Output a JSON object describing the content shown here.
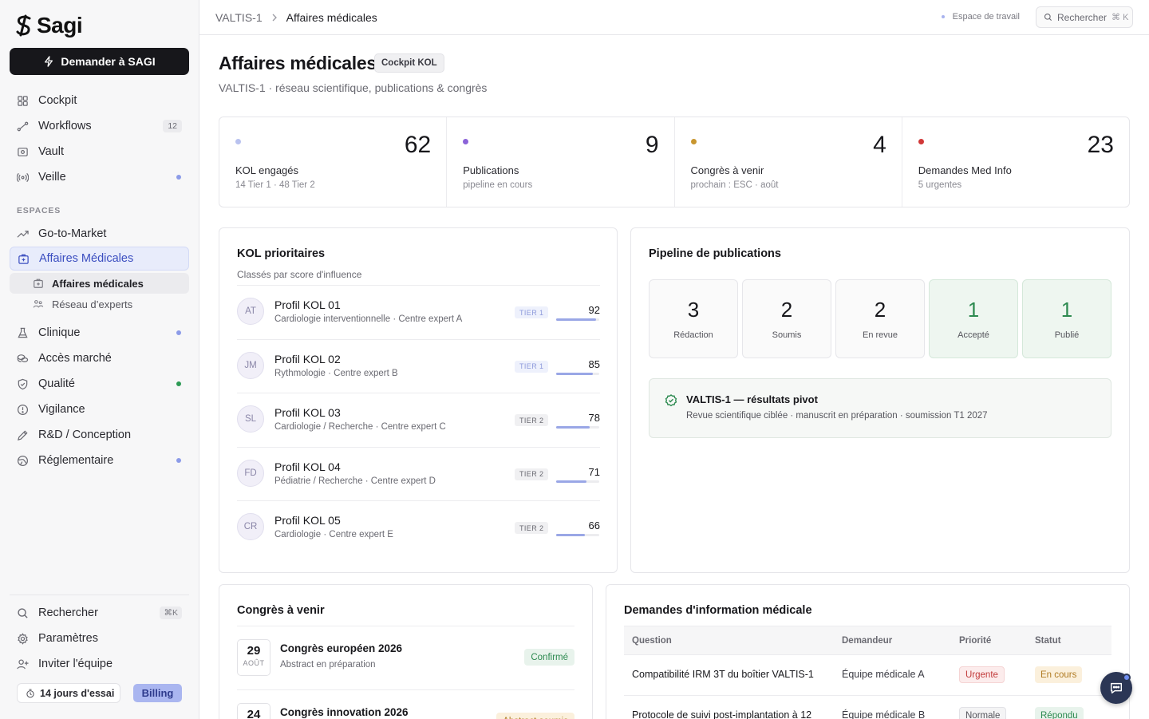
{
  "app": {
    "name": "Sagi"
  },
  "sidebar": {
    "ask_button": "Demander à SAGI",
    "items": [
      {
        "label": "Cockpit",
        "icon": "grid-icon"
      },
      {
        "label": "Workflows",
        "icon": "workflow-icon",
        "badge": "12"
      },
      {
        "label": "Vault",
        "icon": "vault-icon"
      },
      {
        "label": "Veille",
        "icon": "radar-icon"
      }
    ],
    "section_label": "ESPACES",
    "spaces": [
      {
        "label": "Go-to-Market",
        "icon": "trend-icon"
      },
      {
        "label": "Affaires Médicales",
        "icon": "medical-bag-icon"
      },
      {
        "label": "Clinique",
        "icon": "flask-icon"
      },
      {
        "label": "Accès marché",
        "icon": "coins-icon"
      },
      {
        "label": "Qualité",
        "icon": "shield-check-icon"
      },
      {
        "label": "Vigilance",
        "icon": "alert-circle-icon"
      },
      {
        "label": "R&D / Conception",
        "icon": "pencil-ruler-icon"
      },
      {
        "label": "Réglementaire",
        "icon": "globe-icon"
      }
    ],
    "subitems": [
      {
        "label": "Affaires médicales",
        "icon": "medical-bag-icon"
      },
      {
        "label": "Réseau d’experts",
        "icon": "network-icon"
      }
    ],
    "bottom": [
      {
        "label": "Rechercher",
        "icon": "search-icon",
        "kbd": "⌘K"
      },
      {
        "label": "Paramètres",
        "icon": "gear-icon"
      },
      {
        "label": "Inviter l'équipe",
        "icon": "user-plus-icon"
      }
    ],
    "trial": "14 jours d'essai",
    "billing": "Billing",
    "dot_colors": {
      "blue": "#8c9be8",
      "green": "#2d9a55"
    }
  },
  "topbar": {
    "breadcrumb": [
      "VALTIS-1",
      "Affaires médicales"
    ],
    "workspace": "Espace de travail",
    "search_placeholder": "Rechercher",
    "search_kbd": "⌘ K"
  },
  "page": {
    "title": "Affaires médicales",
    "chip": "Cockpit KOL",
    "subtitle": "VALTIS-1 · réseau scientifique, publications & congrès"
  },
  "stats": [
    {
      "value": "62",
      "label": "KOL engagés",
      "sub": "14 Tier 1 · 48 Tier 2",
      "color": "#b9c2ef"
    },
    {
      "value": "9",
      "label": "Publications",
      "sub": "pipeline en cours",
      "color": "#8b63d8"
    },
    {
      "value": "4",
      "label": "Congrès à venir",
      "sub": "prochain : ESC · août",
      "color": "#c8962f"
    },
    {
      "value": "23",
      "label": "Demandes Med Info",
      "sub": "5 urgentes",
      "color": "#d13838"
    }
  ],
  "kol": {
    "title": "KOL prioritaires",
    "subtitle": "Classés par score d'influence",
    "rows": [
      {
        "initials": "AT",
        "name": "Profil KOL 01",
        "spec": "Cardiologie interventionnelle · Centre expert A",
        "tier": "TIER 1",
        "score": "92",
        "level": 0.92
      },
      {
        "initials": "JM",
        "name": "Profil KOL 02",
        "spec": "Rythmologie · Centre expert B",
        "tier": "TIER 1",
        "score": "85",
        "level": 0.85
      },
      {
        "initials": "SL",
        "name": "Profil KOL 03",
        "spec": "Cardiologie / Recherche · Centre expert C",
        "tier": "TIER 2",
        "score": "78",
        "level": 0.78
      },
      {
        "initials": "FD",
        "name": "Profil KOL 04",
        "spec": "Pédiatrie / Recherche · Centre expert D",
        "tier": "TIER 2",
        "score": "71",
        "level": 0.71
      },
      {
        "initials": "CR",
        "name": "Profil KOL 05",
        "spec": "Cardiologie · Centre expert E",
        "tier": "TIER 2",
        "score": "66",
        "level": 0.66
      }
    ]
  },
  "pipeline": {
    "title": "Pipeline de publications",
    "stages": [
      {
        "value": "3",
        "label": "Rédaction"
      },
      {
        "value": "2",
        "label": "Soumis"
      },
      {
        "value": "2",
        "label": "En revue"
      },
      {
        "value": "1",
        "label": "Accepté"
      },
      {
        "value": "1",
        "label": "Publié"
      }
    ],
    "note_title": "VALTIS-1 — résultats pivot",
    "note_sub": "Revue scientifique ciblée · manuscrit en préparation · soumission T1 2027"
  },
  "congres": {
    "title": "Congrès à venir",
    "rows": [
      {
        "day": "29",
        "month": "AOÛT",
        "name": "Congrès européen 2026",
        "sub": "Abstract en préparation",
        "status": "Confirmé"
      },
      {
        "day": "24",
        "month": "",
        "name": "Congrès innovation 2026",
        "sub": "",
        "status": "Abstract soumis"
      }
    ]
  },
  "medinfo": {
    "title": "Demandes d'information médicale",
    "headers": [
      "Question",
      "Demandeur",
      "Priorité",
      "Statut"
    ],
    "rows": [
      {
        "question": "Compatibilité IRM 3T du boîtier VALTIS-1",
        "requester": "Équipe médicale A",
        "priority": "Urgente",
        "status": "En cours"
      },
      {
        "question": "Protocole de suivi post-implantation à 12",
        "requester": "Équipe médicale B",
        "priority": "Normale",
        "status": "Répondu"
      }
    ]
  }
}
